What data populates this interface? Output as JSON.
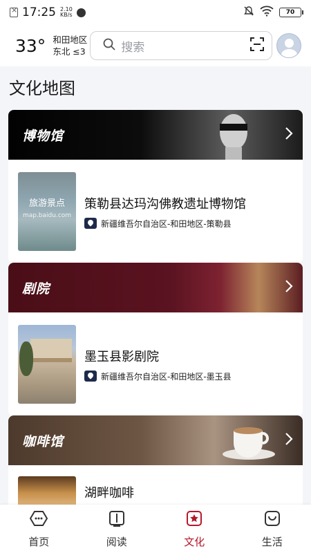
{
  "status": {
    "time": "17:25",
    "net_speed_value": "2.10",
    "net_speed_unit": "KB/s",
    "battery": "70"
  },
  "header": {
    "temperature": "33°",
    "location": "和田地区",
    "wind": "东北  ≤3",
    "search_placeholder": "搜索"
  },
  "page_title": "文化地图",
  "categories": [
    {
      "title": "博物馆",
      "item": {
        "name": "策勒县达玛沟佛教遗址博物馆",
        "address": "新疆维吾尔自治区-和田地区-策勒县",
        "thumb_title": "旅游景点",
        "thumb_sub": "map.baidu.com"
      }
    },
    {
      "title": "剧院",
      "item": {
        "name": "墨玉县影剧院",
        "address": "新疆维吾尔自治区-和田地区-墨玉县"
      }
    },
    {
      "title": "咖啡馆",
      "item": {
        "name": "湖畔咖啡"
      }
    }
  ],
  "nav": [
    {
      "label": "首页",
      "icon": "home-icon"
    },
    {
      "label": "阅读",
      "icon": "book-icon"
    },
    {
      "label": "文化",
      "icon": "culture-icon"
    },
    {
      "label": "生活",
      "icon": "life-icon"
    }
  ],
  "colors": {
    "accent": "#b4182b",
    "background": "#f4f5f9"
  }
}
